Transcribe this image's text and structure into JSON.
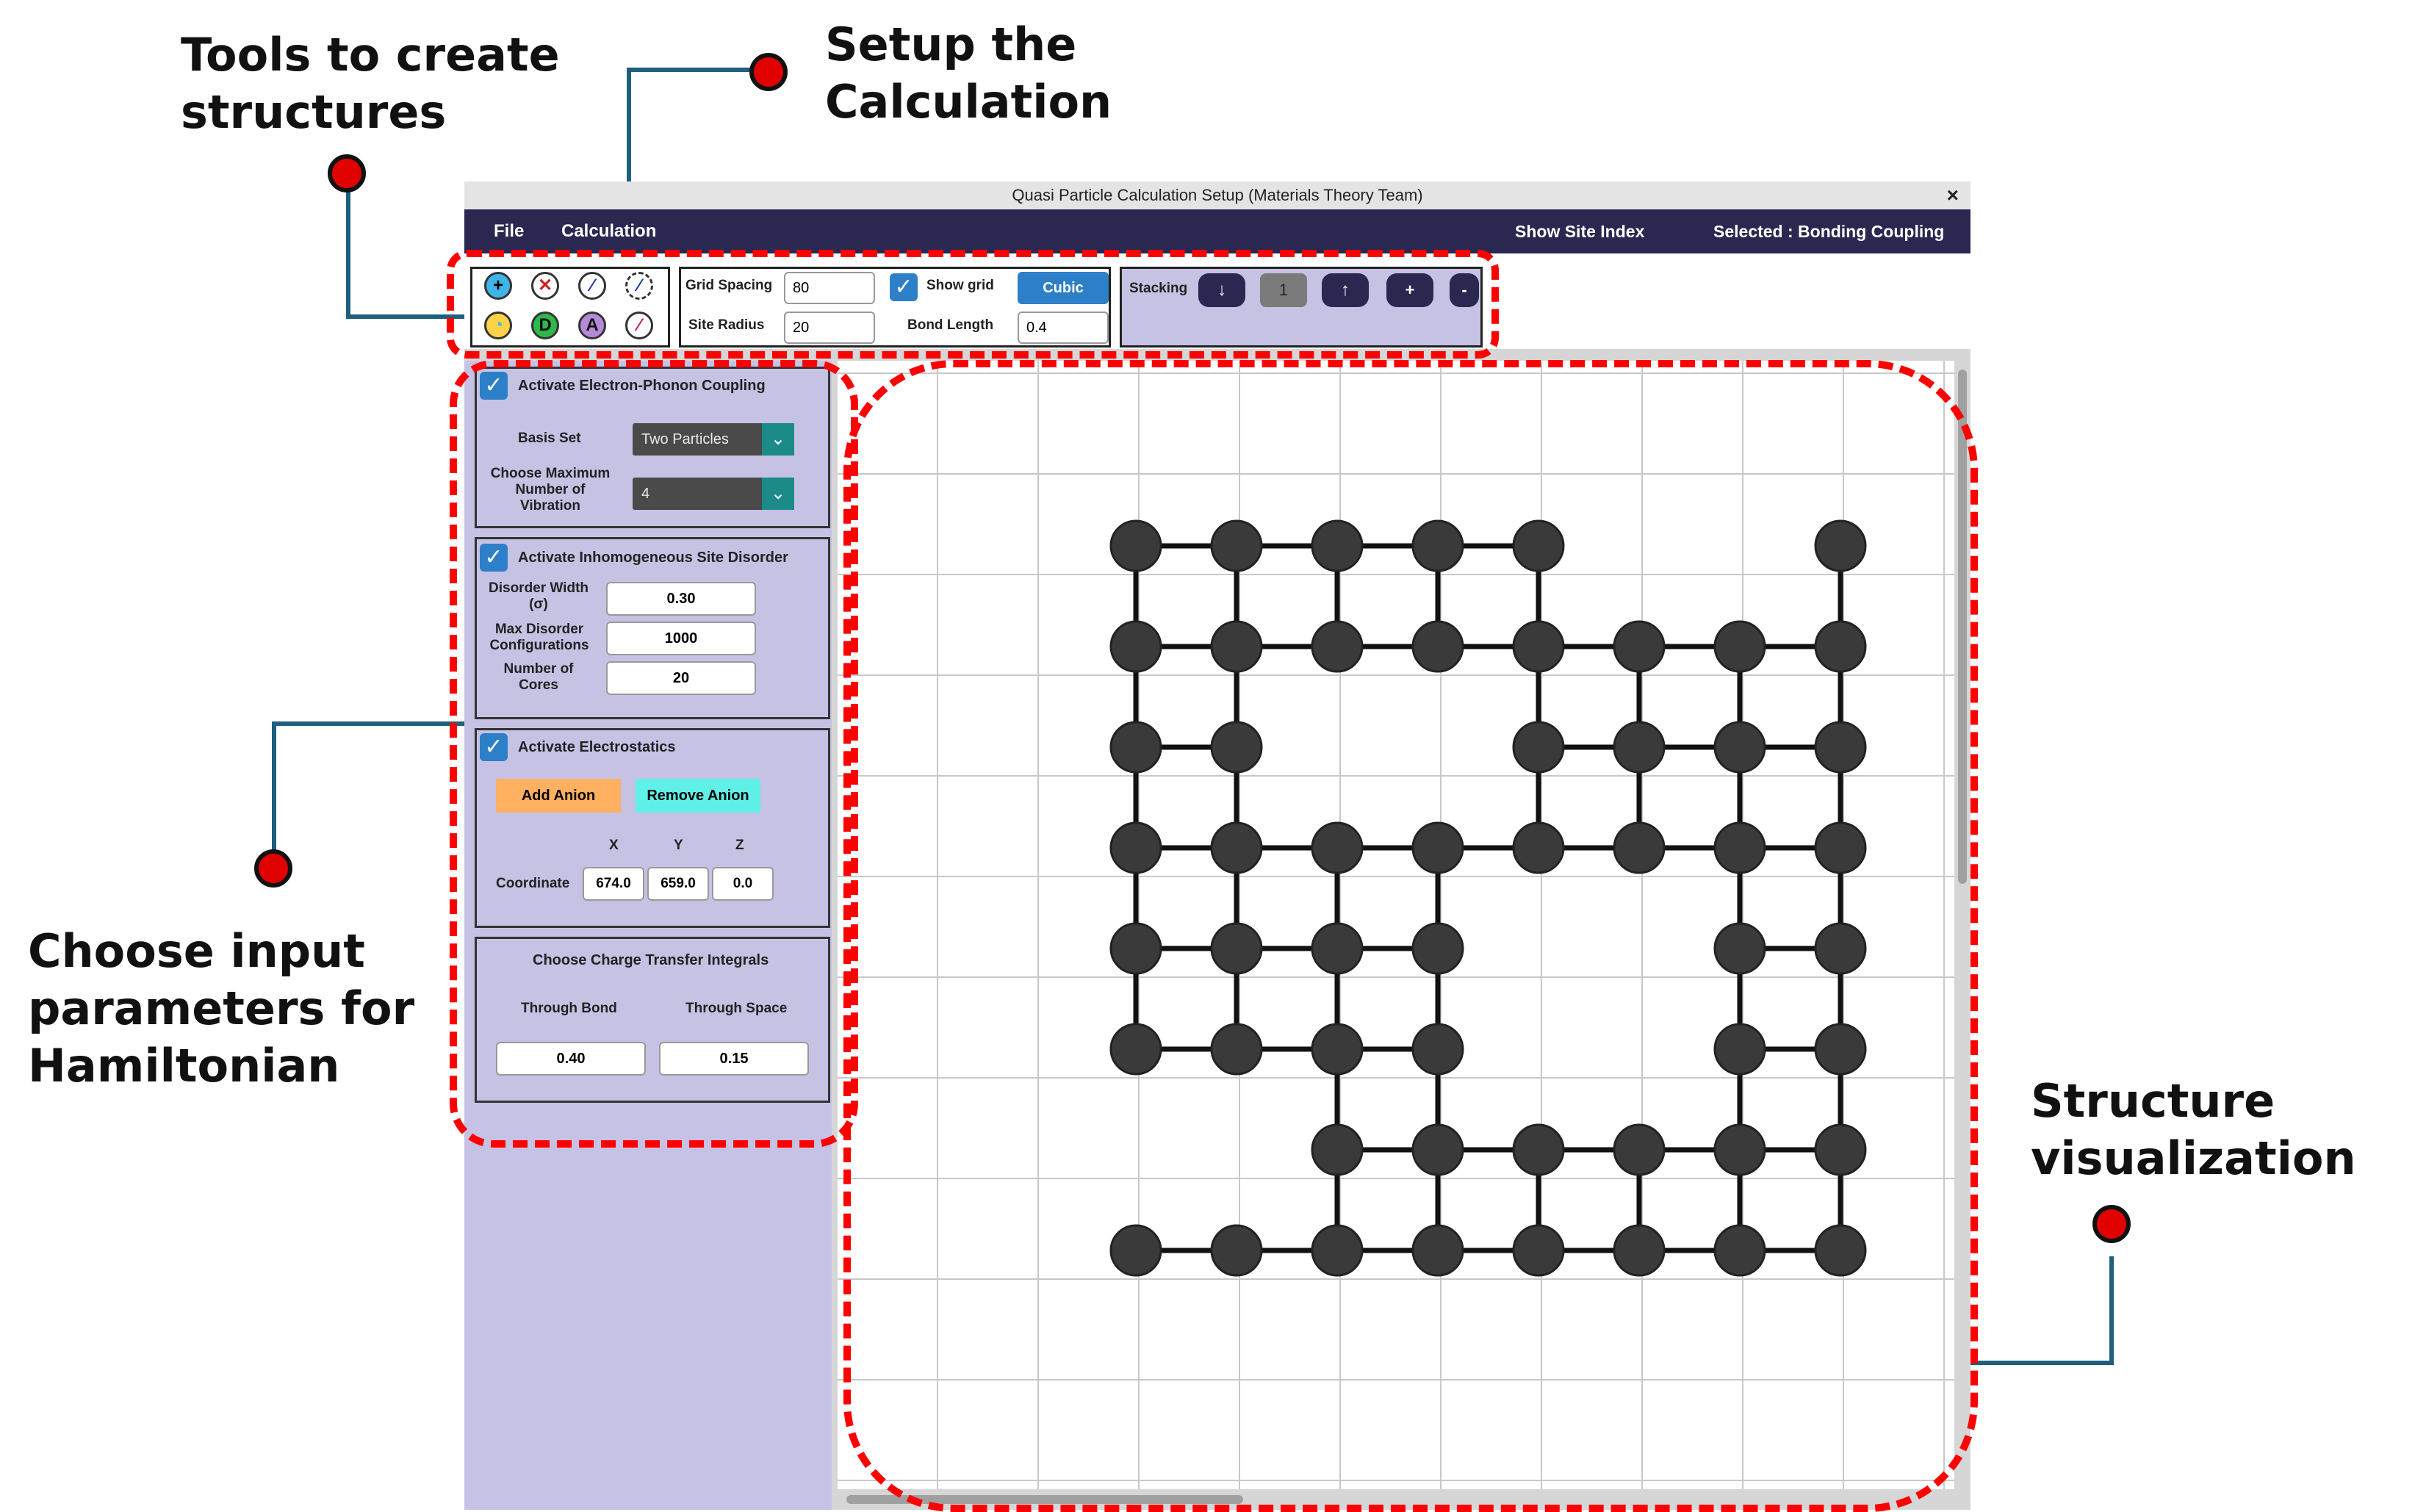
{
  "annotations": {
    "tools": [
      "Tools to create",
      "structures"
    ],
    "setup": [
      "Setup the",
      "Calculation"
    ],
    "params": [
      "Choose input",
      "parameters for",
      "Hamiltonian"
    ],
    "structure": [
      "Structure",
      "visualization"
    ]
  },
  "window": {
    "title": "Quasi Particle Calculation Setup (Materials Theory Team)",
    "close": "×"
  },
  "menubar": {
    "file": "File",
    "calculation": "Calculation",
    "show_site_index": "Show Site Index",
    "selected": "Selected : Bonding Coupling"
  },
  "toolbar": {
    "tools": [
      "add-site-icon",
      "delete-site-icon",
      "bond-icon",
      "dashed-bond-icon",
      "anion-icon",
      "donor-icon",
      "acceptor-icon",
      "remove-bond-icon"
    ],
    "tool_glyphs": [
      "+",
      "✕",
      "⁄",
      "⁄",
      "◔",
      "D",
      "A",
      "⁄"
    ],
    "grid_spacing_label": "Grid Spacing",
    "grid_spacing_value": "80",
    "site_radius_label": "Site Radius",
    "site_radius_value": "20",
    "show_grid_label": "Show grid",
    "lattice_button": "Cubic",
    "bond_length_label": "Bond Length",
    "bond_length_value": "0.4",
    "stacking_label": "Stacking",
    "stack_down": "↓",
    "stack_value": "1",
    "stack_up": "↑",
    "stack_add": "+",
    "stack_remove": "-"
  },
  "panel": {
    "phonon": {
      "title": "Activate Electron-Phonon Coupling",
      "basis_label": "Basis Set",
      "basis_value": "Two Particles",
      "vib_label": [
        "Choose Maximum",
        "Number of",
        "Vibration"
      ],
      "vib_value": "4"
    },
    "disorder": {
      "title": "Activate Inhomogeneous Site Disorder",
      "width_label": [
        "Disorder Width",
        "(σ)"
      ],
      "width_value": "0.30",
      "configs_label": [
        "Max Disorder",
        "Configurations"
      ],
      "configs_value": "1000",
      "cores_label": [
        "Number of",
        "Cores"
      ],
      "cores_value": "20"
    },
    "electrostatics": {
      "title": "Activate Electrostatics",
      "add_anion": "Add Anion",
      "remove_anion": "Remove Anion",
      "x_label": "X",
      "y_label": "Y",
      "z_label": "Z",
      "coord_label": "Coordinate",
      "x_value": "674.0",
      "y_value": "659.0",
      "z_value": "0.0"
    },
    "transfer": {
      "title": "Choose Charge Transfer Integrals",
      "bond_label": "Through Bond",
      "space_label": "Through Space",
      "bond_value": "0.40",
      "space_value": "0.15"
    }
  },
  "colors": {
    "menubar": "#2a2850",
    "panel": "#c5c2e4",
    "accent_blue": "#2d7fc8",
    "add_anion": "#ffb060",
    "remove_anion": "#5ff0e8",
    "annotation_dash": "#ff0000",
    "site": "#3a3a3a"
  },
  "structure": {
    "sites": [
      [
        3,
        1
      ],
      [
        4,
        1
      ],
      [
        5,
        1
      ],
      [
        6,
        1
      ],
      [
        7,
        1
      ],
      [
        10,
        1
      ],
      [
        3,
        2
      ],
      [
        4,
        2
      ],
      [
        5,
        2
      ],
      [
        6,
        2
      ],
      [
        7,
        2
      ],
      [
        8,
        2
      ],
      [
        9,
        2
      ],
      [
        10,
        2
      ],
      [
        3,
        3
      ],
      [
        4,
        3
      ],
      [
        7,
        3
      ],
      [
        8,
        3
      ],
      [
        9,
        3
      ],
      [
        10,
        3
      ],
      [
        3,
        4
      ],
      [
        4,
        4
      ],
      [
        5,
        4
      ],
      [
        6,
        4
      ],
      [
        7,
        4
      ],
      [
        8,
        4
      ],
      [
        9,
        4
      ],
      [
        10,
        4
      ],
      [
        3,
        5
      ],
      [
        4,
        5
      ],
      [
        5,
        5
      ],
      [
        6,
        5
      ],
      [
        9,
        5
      ],
      [
        10,
        5
      ],
      [
        3,
        6
      ],
      [
        4,
        6
      ],
      [
        5,
        6
      ],
      [
        6,
        6
      ],
      [
        9,
        6
      ],
      [
        10,
        6
      ],
      [
        5,
        7
      ],
      [
        6,
        7
      ],
      [
        7,
        7
      ],
      [
        8,
        7
      ],
      [
        9,
        7
      ],
      [
        10,
        7
      ],
      [
        3,
        8
      ],
      [
        4,
        8
      ],
      [
        5,
        8
      ],
      [
        6,
        8
      ],
      [
        7,
        8
      ],
      [
        8,
        8
      ],
      [
        9,
        8
      ],
      [
        10,
        8
      ]
    ]
  }
}
